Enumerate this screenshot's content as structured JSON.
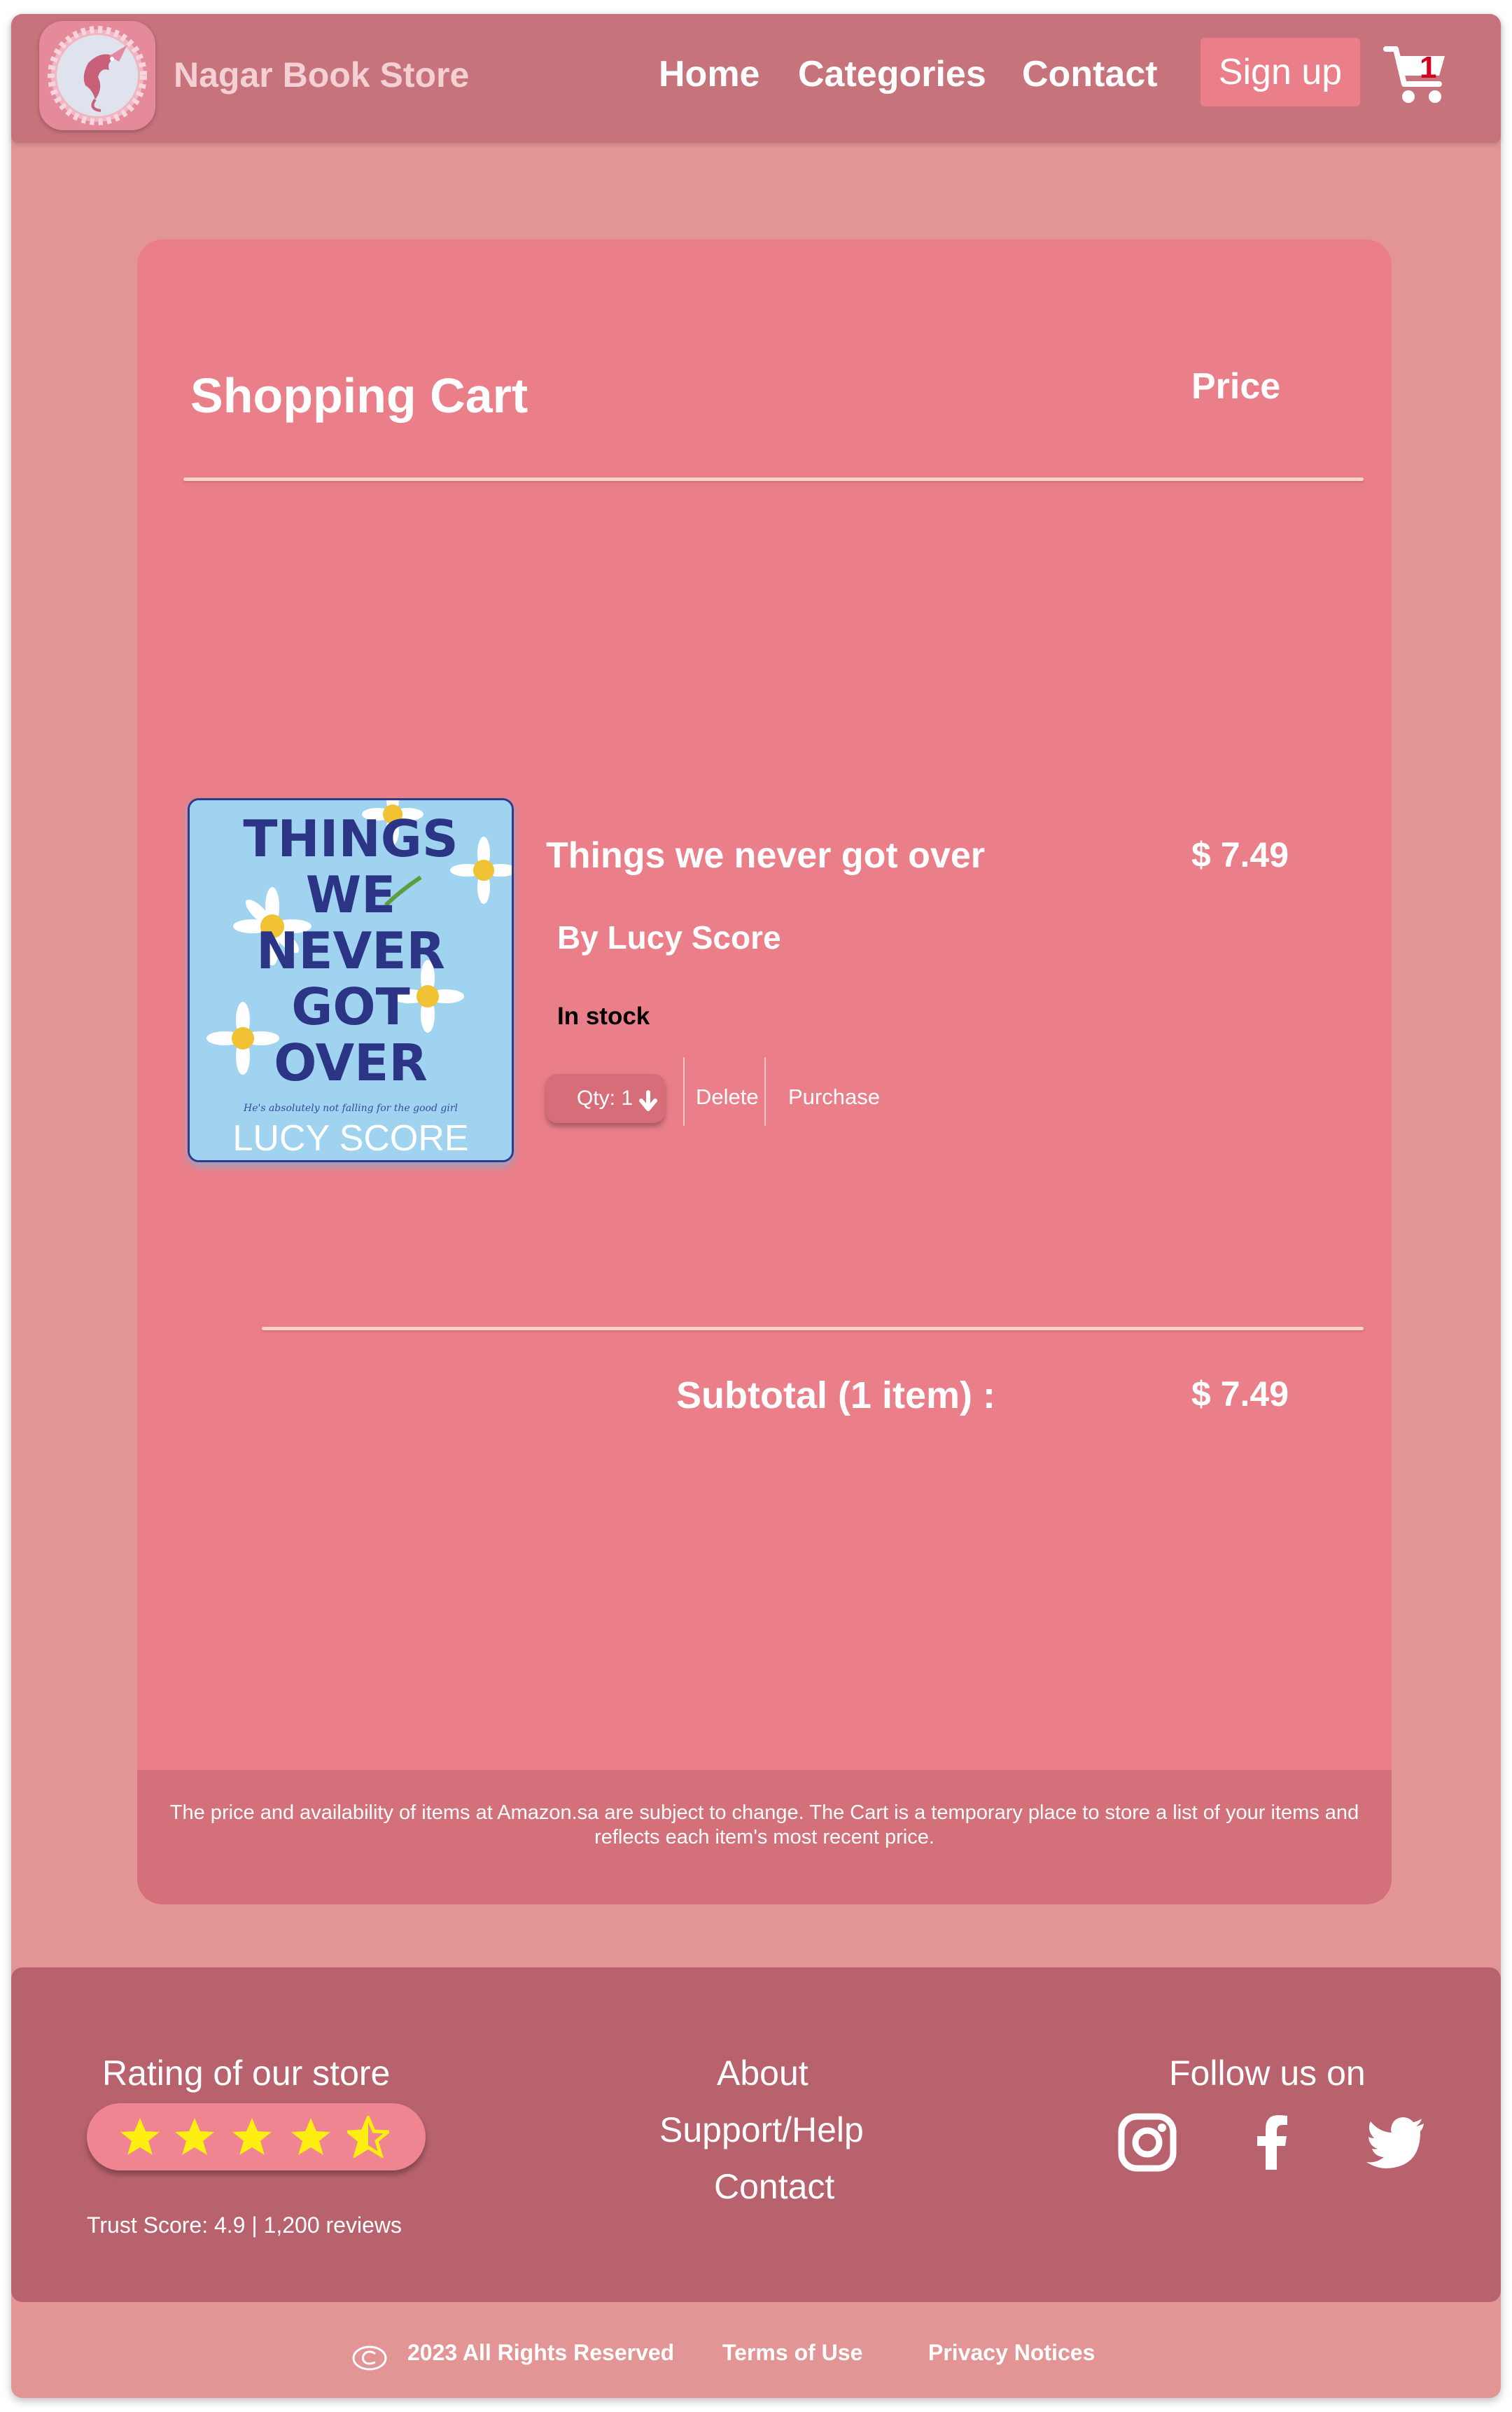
{
  "header": {
    "brand": "Nagar Book Store",
    "nav": {
      "home": "Home",
      "categories": "Categories",
      "contact": "Contact"
    },
    "signup": "Sign up",
    "cart_count": "1"
  },
  "cart": {
    "title": "Shopping Cart",
    "price_heading": "Price",
    "item": {
      "title": "Things we never got over",
      "price": "$ 7.49",
      "author": "By Lucy Score",
      "stock": "In stock",
      "qty": "Qty: 1",
      "delete": "Delete",
      "purchase": "Purchase",
      "cover": {
        "title_lines": [
          "THINGS",
          "WE",
          "NEVER",
          "GOT",
          "OVER"
        ],
        "tagline": "He's absolutely not falling for the good girl",
        "author": "LUCY SCORE"
      }
    },
    "subtotal_label": "Subtotal (1 item) :",
    "subtotal_value": "$ 7.49",
    "note": "The price and availability of items at Amazon.sa are subject to change. The Cart is a temporary place to store a list of your items and reflects each item's most recent price."
  },
  "footer": {
    "rating_title": "Rating of our store",
    "rating_stars": 4.5,
    "trust": "Trust Score: 4.9 | 1,200 reviews",
    "links": {
      "about": "About",
      "support": "Support/Help",
      "contact": "Contact"
    },
    "follow_title": "Follow us on",
    "social": [
      "instagram-icon",
      "facebook-icon",
      "twitter-icon"
    ]
  },
  "bottom": {
    "rights": "2023 All Rights Reserved",
    "terms": "Terms of Use",
    "privacy": "Privacy Notices"
  },
  "colors": {
    "page_bg": "#e39595",
    "header_bg": "#c6737b",
    "card_bg": "#ea7f89",
    "footer_bg": "#b8626d",
    "star": "#ffee11",
    "cart_badge": "#d3001f"
  }
}
